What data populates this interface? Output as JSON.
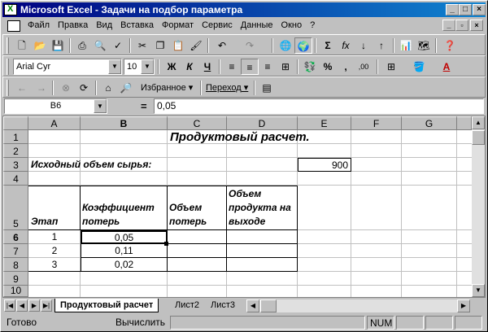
{
  "window": {
    "title": "Microsoft Excel - Задачи на подбор параметра",
    "min_glyph": "_",
    "max_glyph": "□",
    "close_glyph": "×"
  },
  "menu": {
    "items": [
      "Файл",
      "Правка",
      "Вид",
      "Вставка",
      "Формат",
      "Сервис",
      "Данные",
      "Окно",
      "?"
    ],
    "doc_min_glyph": "_",
    "doc_restore_glyph": "▫",
    "doc_close_glyph": "×"
  },
  "toolbar_standard": {
    "icons": [
      "new-icon",
      "open-icon",
      "save-icon",
      "print-icon",
      "preview-icon",
      "spelling-icon",
      "cut-icon",
      "copy-icon",
      "paste-icon",
      "format-painter-icon",
      "undo-icon",
      "redo-icon",
      "hyperlink-icon",
      "web-toolbar-icon",
      "autosum-icon",
      "function-icon",
      "sort-asc-icon",
      "sort-desc-icon",
      "chart-wizard-icon",
      "map-icon",
      "help-icon"
    ],
    "autosum_glyph": "Σ",
    "function_glyph": "fx"
  },
  "toolbar_format": {
    "font": "Arial Cyr",
    "size": "10",
    "bold_label": "Ж",
    "italic_label": "К",
    "underline_label": "Ч",
    "percent_label": "%",
    "comma_label": ",",
    "increase_decimal_label": ",00"
  },
  "toolbar_web": {
    "favorites_label": "Избранное",
    "goto_label": "Переход"
  },
  "formula_bar": {
    "name_box": "B6",
    "eq": "=",
    "value": "0,05"
  },
  "sheet": {
    "columns": [
      "A",
      "B",
      "C",
      "D",
      "E",
      "F",
      "G"
    ],
    "rows": [
      "1",
      "2",
      "3",
      "4",
      "5",
      "6",
      "7",
      "8",
      "9",
      "10"
    ],
    "active_cell": "B6",
    "cells": {
      "C1": "Продуктовый расчет.",
      "A3": "Исходный объем сырья:",
      "E3": "900",
      "A5": "Этап",
      "B5": "Коэффициент потерь",
      "C5": "Объем потерь",
      "D5": "Объем продукта на выходе",
      "A6": "1",
      "B6": "0,05",
      "A7": "2",
      "B7": "0,11",
      "A8": "3",
      "B8": "0,02"
    }
  },
  "tabs": {
    "items": [
      "Продуктовый расчет",
      "Лист2",
      "Лист3"
    ],
    "active": "Продуктовый расчет"
  },
  "status": {
    "ready": "Готово",
    "calculate": "Вычислить",
    "num": "NUM"
  }
}
